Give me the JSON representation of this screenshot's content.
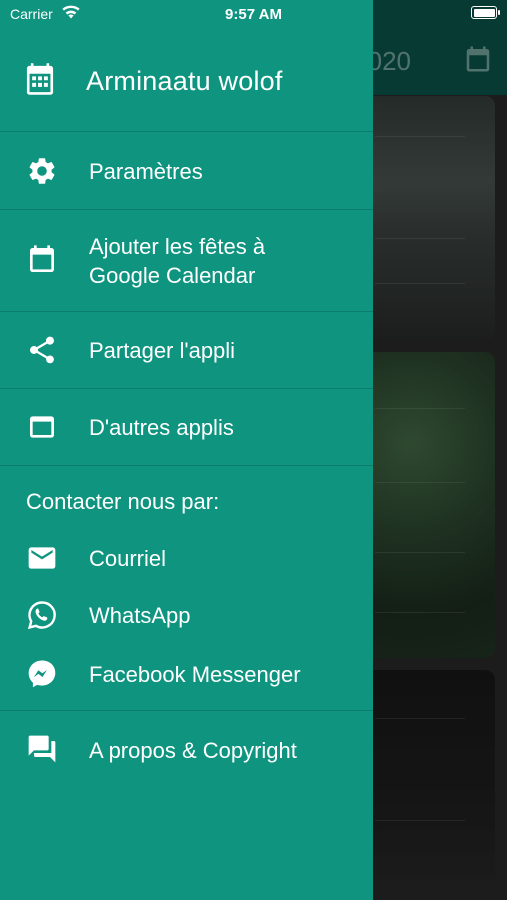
{
  "status_bar": {
    "carrier": "Carrier",
    "time": "9:57 AM"
  },
  "background_app": {
    "year_fragment": "020",
    "header_color": "#0b5a4f"
  },
  "drawer": {
    "background": "#0f9480",
    "app_title": "Arminaatu wolof",
    "header_icon": "calendar-icon",
    "menu_items": [
      {
        "label": "Paramètres",
        "icon": "settings-icon"
      },
      {
        "label": "Ajouter les fêtes à\nGoogle Calendar",
        "icon": "calendar-icon"
      },
      {
        "label": "Partager l'appli",
        "icon": "share-icon"
      },
      {
        "label": "D'autres applis",
        "icon": "window-icon"
      }
    ],
    "contact_section": {
      "title": "Contacter nous par:",
      "items": [
        {
          "label": "Courriel",
          "icon": "mail-icon"
        },
        {
          "label": "WhatsApp",
          "icon": "whatsapp-icon"
        },
        {
          "label": "Facebook Messenger",
          "icon": "messenger-icon"
        }
      ]
    },
    "about": {
      "label": "A propos & Copyright",
      "icon": "chat-icon"
    }
  }
}
